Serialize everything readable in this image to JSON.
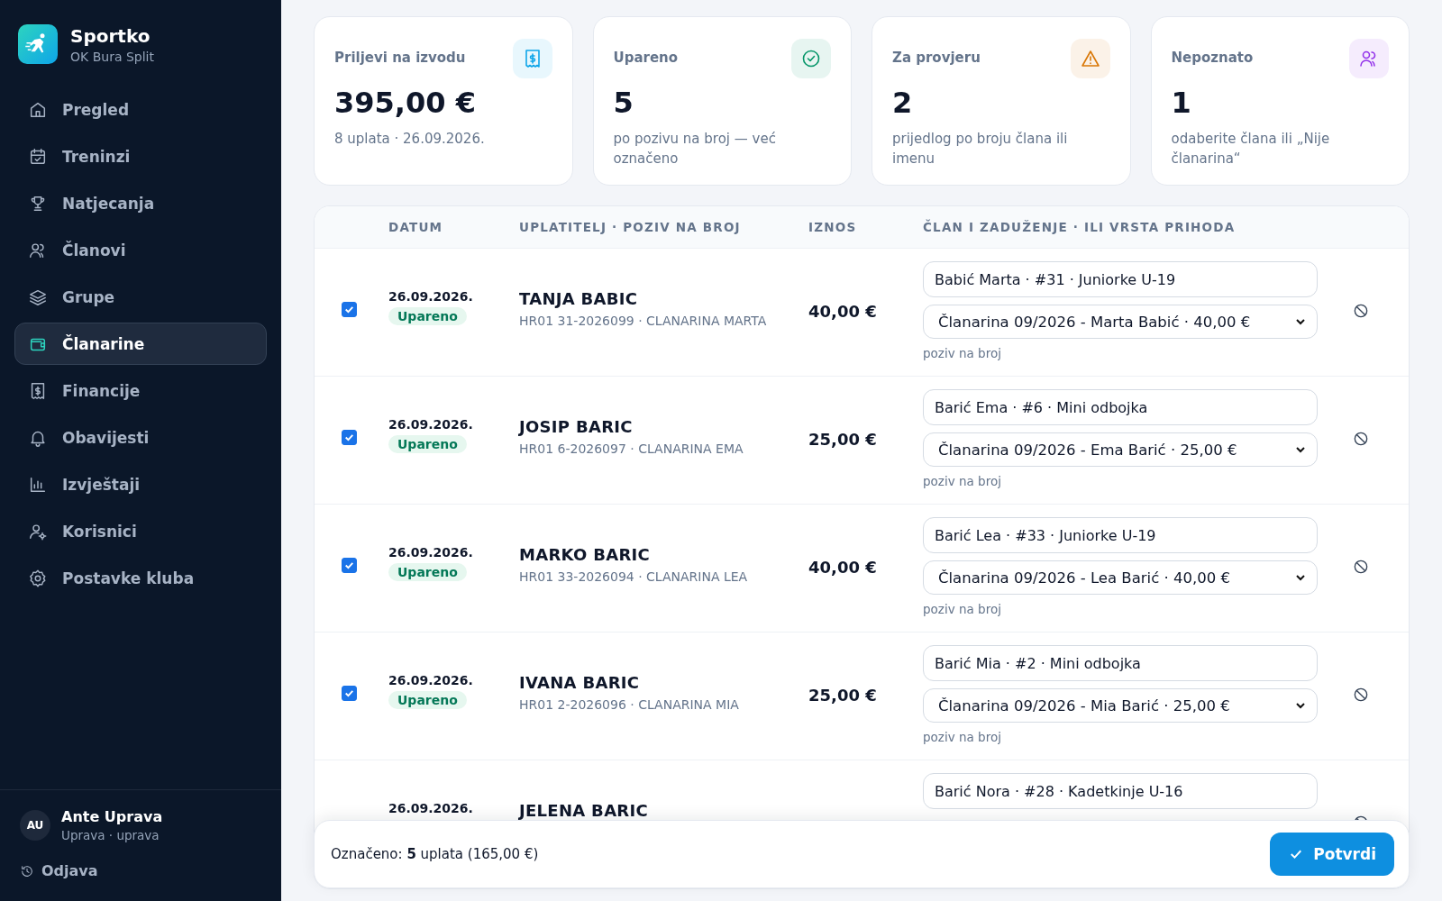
{
  "brand": {
    "name": "Sportko",
    "club": "OK Bura Split"
  },
  "nav": [
    {
      "label": "Pregled",
      "selected": false
    },
    {
      "label": "Treninzi",
      "selected": false
    },
    {
      "label": "Natjecanja",
      "selected": false
    },
    {
      "label": "Članovi",
      "selected": false
    },
    {
      "label": "Grupe",
      "selected": false
    },
    {
      "label": "Članarine",
      "selected": true
    },
    {
      "label": "Financije",
      "selected": false
    },
    {
      "label": "Obavijesti",
      "selected": false
    },
    {
      "label": "Izvještaji",
      "selected": false
    },
    {
      "label": "Korisnici",
      "selected": false
    },
    {
      "label": "Postavke kluba",
      "selected": false
    }
  ],
  "user": {
    "initials": "AU",
    "name": "Ante Uprava",
    "role": "Uprava · uprava",
    "logout": "Odjava"
  },
  "stats": [
    {
      "title": "Priljevi na izvodu",
      "value": "395,00 €",
      "note": "8 uplata · 26.09.2026.",
      "color": "#0ea5e9"
    },
    {
      "title": "Upareno",
      "value": "5",
      "note": "po pozivu na broj — već označeno",
      "color": "#059669"
    },
    {
      "title": "Za provjeru",
      "value": "2",
      "note": "prijedlog po broju člana ili imenu",
      "color": "#d97706"
    },
    {
      "title": "Nepoznato",
      "value": "1",
      "note": "odaberite člana ili „Nije članarina“",
      "color": "#9333ea"
    }
  ],
  "table": {
    "columns": [
      "DATUM",
      "UPLATITELJ · POZIV NA BROJ",
      "IZNOS",
      "ČLAN I ZADUŽENJE · ILI VRSTA PRIHODA"
    ],
    "rows": [
      {
        "checked": true,
        "date": "26.09.2026.",
        "status": "Upareno",
        "payer": "TANJA BABIC",
        "reference": "HR01 31-2026099 · CLANARINA MARTA",
        "amount": "40,00 €",
        "member": "Babić Marta · #31 · Juniorke U-19",
        "charge": "Članarina 09/2026 - Marta Babić · 40,00 €",
        "match": "poziv na broj"
      },
      {
        "checked": true,
        "date": "26.09.2026.",
        "status": "Upareno",
        "payer": "JOSIP BARIC",
        "reference": "HR01 6-2026097 · CLANARINA EMA",
        "amount": "25,00 €",
        "member": "Barić Ema · #6 · Mini odbojka",
        "charge": "Članarina 09/2026 - Ema Barić · 25,00 €",
        "match": "poziv na broj"
      },
      {
        "checked": true,
        "date": "26.09.2026.",
        "status": "Upareno",
        "payer": "MARKO BARIC",
        "reference": "HR01 33-2026094 · CLANARINA LEA",
        "amount": "40,00 €",
        "member": "Barić Lea · #33 · Juniorke U-19",
        "charge": "Članarina 09/2026 - Lea Barić · 40,00 €",
        "match": "poziv na broj"
      },
      {
        "checked": true,
        "date": "26.09.2026.",
        "status": "Upareno",
        "payer": "IVANA BARIC",
        "reference": "HR01 2-2026096 · CLANARINA MIA",
        "amount": "25,00 €",
        "member": "Barić Mia · #2 · Mini odbojka",
        "charge": "Članarina 09/2026 - Mia Barić · 25,00 €",
        "match": "poziv na broj"
      },
      {
        "date": "26.09.2026.",
        "payer": "JELENA BARIC",
        "member": "Barić Nora · #28 · Kadetkinje U-16"
      }
    ]
  },
  "footer": {
    "summary": "Označeno: **5** uplata (165,00 €)",
    "confirm": "Potvrdi"
  }
}
